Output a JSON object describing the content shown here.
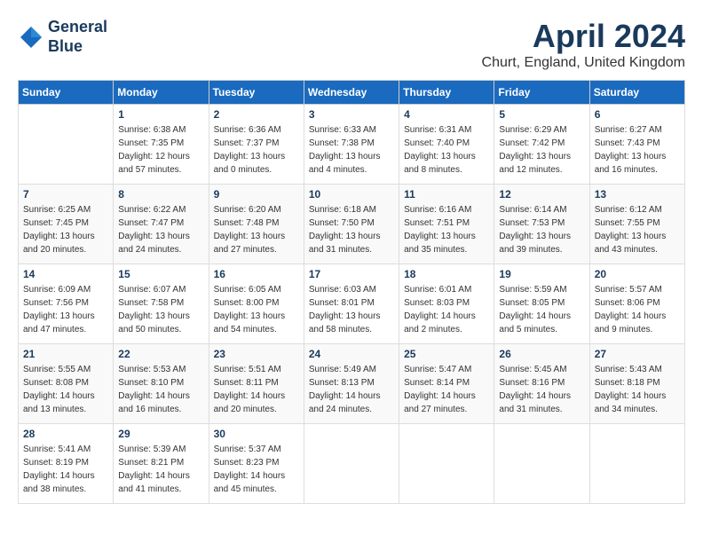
{
  "logo": {
    "line1": "General",
    "line2": "Blue"
  },
  "title": "April 2024",
  "location": "Churt, England, United Kingdom",
  "days_header": [
    "Sunday",
    "Monday",
    "Tuesday",
    "Wednesday",
    "Thursday",
    "Friday",
    "Saturday"
  ],
  "weeks": [
    [
      {
        "day": "",
        "sunrise": "",
        "sunset": "",
        "daylight": ""
      },
      {
        "day": "1",
        "sunrise": "Sunrise: 6:38 AM",
        "sunset": "Sunset: 7:35 PM",
        "daylight": "Daylight: 12 hours and 57 minutes."
      },
      {
        "day": "2",
        "sunrise": "Sunrise: 6:36 AM",
        "sunset": "Sunset: 7:37 PM",
        "daylight": "Daylight: 13 hours and 0 minutes."
      },
      {
        "day": "3",
        "sunrise": "Sunrise: 6:33 AM",
        "sunset": "Sunset: 7:38 PM",
        "daylight": "Daylight: 13 hours and 4 minutes."
      },
      {
        "day": "4",
        "sunrise": "Sunrise: 6:31 AM",
        "sunset": "Sunset: 7:40 PM",
        "daylight": "Daylight: 13 hours and 8 minutes."
      },
      {
        "day": "5",
        "sunrise": "Sunrise: 6:29 AM",
        "sunset": "Sunset: 7:42 PM",
        "daylight": "Daylight: 13 hours and 12 minutes."
      },
      {
        "day": "6",
        "sunrise": "Sunrise: 6:27 AM",
        "sunset": "Sunset: 7:43 PM",
        "daylight": "Daylight: 13 hours and 16 minutes."
      }
    ],
    [
      {
        "day": "7",
        "sunrise": "Sunrise: 6:25 AM",
        "sunset": "Sunset: 7:45 PM",
        "daylight": "Daylight: 13 hours and 20 minutes."
      },
      {
        "day": "8",
        "sunrise": "Sunrise: 6:22 AM",
        "sunset": "Sunset: 7:47 PM",
        "daylight": "Daylight: 13 hours and 24 minutes."
      },
      {
        "day": "9",
        "sunrise": "Sunrise: 6:20 AM",
        "sunset": "Sunset: 7:48 PM",
        "daylight": "Daylight: 13 hours and 27 minutes."
      },
      {
        "day": "10",
        "sunrise": "Sunrise: 6:18 AM",
        "sunset": "Sunset: 7:50 PM",
        "daylight": "Daylight: 13 hours and 31 minutes."
      },
      {
        "day": "11",
        "sunrise": "Sunrise: 6:16 AM",
        "sunset": "Sunset: 7:51 PM",
        "daylight": "Daylight: 13 hours and 35 minutes."
      },
      {
        "day": "12",
        "sunrise": "Sunrise: 6:14 AM",
        "sunset": "Sunset: 7:53 PM",
        "daylight": "Daylight: 13 hours and 39 minutes."
      },
      {
        "day": "13",
        "sunrise": "Sunrise: 6:12 AM",
        "sunset": "Sunset: 7:55 PM",
        "daylight": "Daylight: 13 hours and 43 minutes."
      }
    ],
    [
      {
        "day": "14",
        "sunrise": "Sunrise: 6:09 AM",
        "sunset": "Sunset: 7:56 PM",
        "daylight": "Daylight: 13 hours and 47 minutes."
      },
      {
        "day": "15",
        "sunrise": "Sunrise: 6:07 AM",
        "sunset": "Sunset: 7:58 PM",
        "daylight": "Daylight: 13 hours and 50 minutes."
      },
      {
        "day": "16",
        "sunrise": "Sunrise: 6:05 AM",
        "sunset": "Sunset: 8:00 PM",
        "daylight": "Daylight: 13 hours and 54 minutes."
      },
      {
        "day": "17",
        "sunrise": "Sunrise: 6:03 AM",
        "sunset": "Sunset: 8:01 PM",
        "daylight": "Daylight: 13 hours and 58 minutes."
      },
      {
        "day": "18",
        "sunrise": "Sunrise: 6:01 AM",
        "sunset": "Sunset: 8:03 PM",
        "daylight": "Daylight: 14 hours and 2 minutes."
      },
      {
        "day": "19",
        "sunrise": "Sunrise: 5:59 AM",
        "sunset": "Sunset: 8:05 PM",
        "daylight": "Daylight: 14 hours and 5 minutes."
      },
      {
        "day": "20",
        "sunrise": "Sunrise: 5:57 AM",
        "sunset": "Sunset: 8:06 PM",
        "daylight": "Daylight: 14 hours and 9 minutes."
      }
    ],
    [
      {
        "day": "21",
        "sunrise": "Sunrise: 5:55 AM",
        "sunset": "Sunset: 8:08 PM",
        "daylight": "Daylight: 14 hours and 13 minutes."
      },
      {
        "day": "22",
        "sunrise": "Sunrise: 5:53 AM",
        "sunset": "Sunset: 8:10 PM",
        "daylight": "Daylight: 14 hours and 16 minutes."
      },
      {
        "day": "23",
        "sunrise": "Sunrise: 5:51 AM",
        "sunset": "Sunset: 8:11 PM",
        "daylight": "Daylight: 14 hours and 20 minutes."
      },
      {
        "day": "24",
        "sunrise": "Sunrise: 5:49 AM",
        "sunset": "Sunset: 8:13 PM",
        "daylight": "Daylight: 14 hours and 24 minutes."
      },
      {
        "day": "25",
        "sunrise": "Sunrise: 5:47 AM",
        "sunset": "Sunset: 8:14 PM",
        "daylight": "Daylight: 14 hours and 27 minutes."
      },
      {
        "day": "26",
        "sunrise": "Sunrise: 5:45 AM",
        "sunset": "Sunset: 8:16 PM",
        "daylight": "Daylight: 14 hours and 31 minutes."
      },
      {
        "day": "27",
        "sunrise": "Sunrise: 5:43 AM",
        "sunset": "Sunset: 8:18 PM",
        "daylight": "Daylight: 14 hours and 34 minutes."
      }
    ],
    [
      {
        "day": "28",
        "sunrise": "Sunrise: 5:41 AM",
        "sunset": "Sunset: 8:19 PM",
        "daylight": "Daylight: 14 hours and 38 minutes."
      },
      {
        "day": "29",
        "sunrise": "Sunrise: 5:39 AM",
        "sunset": "Sunset: 8:21 PM",
        "daylight": "Daylight: 14 hours and 41 minutes."
      },
      {
        "day": "30",
        "sunrise": "Sunrise: 5:37 AM",
        "sunset": "Sunset: 8:23 PM",
        "daylight": "Daylight: 14 hours and 45 minutes."
      },
      {
        "day": "",
        "sunrise": "",
        "sunset": "",
        "daylight": ""
      },
      {
        "day": "",
        "sunrise": "",
        "sunset": "",
        "daylight": ""
      },
      {
        "day": "",
        "sunrise": "",
        "sunset": "",
        "daylight": ""
      },
      {
        "day": "",
        "sunrise": "",
        "sunset": "",
        "daylight": ""
      }
    ]
  ]
}
